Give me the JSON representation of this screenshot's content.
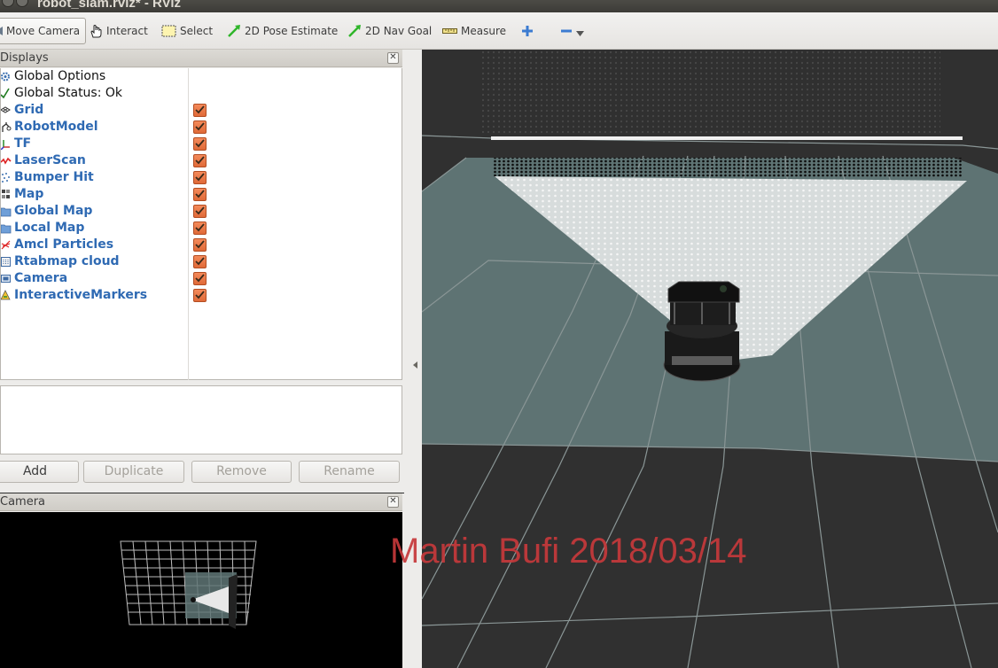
{
  "window": {
    "title": "robot_slam.rviz* - RViz"
  },
  "toolbar": {
    "tools": [
      {
        "label": "Move Camera",
        "icon": "move-camera-icon",
        "active": true
      },
      {
        "label": "Interact",
        "icon": "hand-icon"
      },
      {
        "label": "Select",
        "icon": "select-box-icon"
      },
      {
        "label": "2D Pose Estimate",
        "icon": "green-arrow-icon"
      },
      {
        "label": "2D Nav Goal",
        "icon": "green-arrow-icon"
      },
      {
        "label": "Measure",
        "icon": "ruler-icon"
      }
    ],
    "extra_icons": [
      "plus-icon",
      "minus-icon",
      "dropdown-arrow-icon"
    ]
  },
  "displays_panel": {
    "title": "Displays",
    "items": [
      {
        "label": "Global Options",
        "icon": "gear-icon",
        "style": "plain"
      },
      {
        "label": "Global Status: Ok",
        "icon": "check-icon",
        "style": "plain"
      },
      {
        "label": "Grid",
        "icon": "grid-icon",
        "style": "link",
        "checked": true
      },
      {
        "label": "RobotModel",
        "icon": "robot-icon",
        "style": "link",
        "checked": true
      },
      {
        "label": "TF",
        "icon": "axes-icon",
        "style": "link",
        "checked": true
      },
      {
        "label": "LaserScan",
        "icon": "laser-icon",
        "style": "link",
        "checked": true
      },
      {
        "label": "Bumper Hit",
        "icon": "points-icon",
        "style": "link",
        "checked": true
      },
      {
        "label": "Map",
        "icon": "map-icon",
        "style": "link",
        "checked": true
      },
      {
        "label": "Global Map",
        "icon": "folder-icon",
        "style": "link",
        "checked": true
      },
      {
        "label": "Local Map",
        "icon": "folder-icon",
        "style": "link",
        "checked": true
      },
      {
        "label": "Amcl Particles",
        "icon": "pose-array-icon",
        "style": "link",
        "checked": true
      },
      {
        "label": "Rtabmap cloud",
        "icon": "cloud-icon",
        "style": "link",
        "checked": true
      },
      {
        "label": "Camera",
        "icon": "camera-icon",
        "style": "link",
        "checked": true
      },
      {
        "label": "InteractiveMarkers",
        "icon": "marker-icon",
        "style": "link",
        "checked": true
      }
    ],
    "buttons": {
      "add": "Add",
      "duplicate": "Duplicate",
      "remove": "Remove",
      "rename": "Rename"
    }
  },
  "camera_panel": {
    "title": "Camera"
  },
  "overlay": {
    "watermark": "Martin Bufi 2018/03/14"
  },
  "colors": {
    "checkbox": "#e8703c",
    "link_text": "#2f6ab3",
    "watermark": "#c6393b",
    "floor": "#5e7373",
    "background_3d": "#303030"
  }
}
